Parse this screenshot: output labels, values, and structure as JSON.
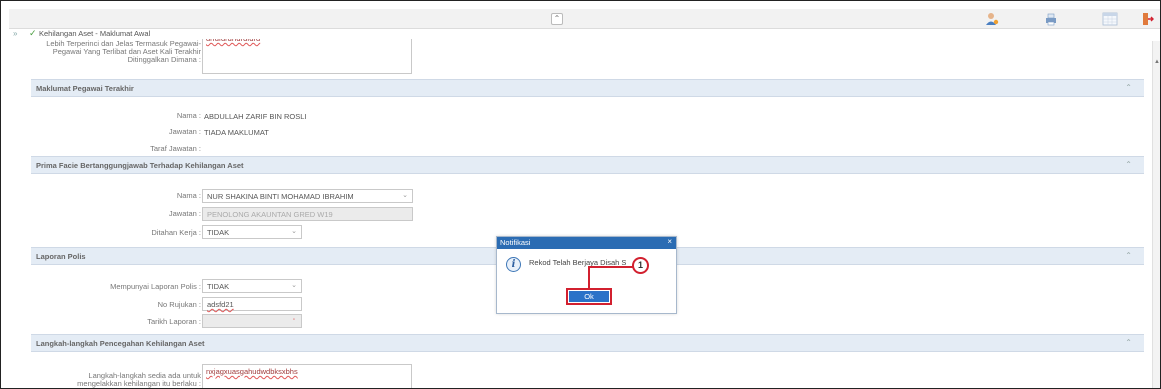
{
  "toolbar": {
    "collapse_icon": "double-chevron-up-icon",
    "icons": [
      "user-settings-icon",
      "print-icon",
      "calendar-icon",
      "logout-icon"
    ]
  },
  "breadcrumb": {
    "arrows": "»",
    "check": "✓",
    "label": "Kehilangan Aset - Maklumat Awal"
  },
  "top_section": {
    "label_lines": [
      "Lebih Terperinci dan Jelas Termasuk Pegawai-",
      "Pegawai Yang Terlibat dan Aset Kali Terakhir",
      "Ditinggalkan Dimana :"
    ],
    "textarea_value": "drfdfdrdrfdrdfdrd"
  },
  "pegawai_terakhir": {
    "title": "Maklumat Pegawai Terakhir",
    "nama_label": "Nama :",
    "nama_value": "ABDULLAH ZARIF BIN ROSLI",
    "jawatan_label": "Jawatan :",
    "jawatan_value": "TIADA MAKLUMAT",
    "taraf_label": "Taraf Jawatan :",
    "taraf_value": ""
  },
  "prima_facie": {
    "title": "Prima Facie Bertanggungjawab Terhadap Kehilangan Aset",
    "nama_label": "Nama :",
    "nama_value": "NUR SHAKINA BINTI MOHAMAD IBRAHIM",
    "jawatan_label": "Jawatan :",
    "jawatan_value": "PENOLONG AKAUNTAN GRED W19",
    "ditahan_label": "Ditahan Kerja :",
    "ditahan_value": "TIDAK"
  },
  "laporan_polis": {
    "title": "Laporan Polis",
    "mempunyai_label": "Mempunyai Laporan Polis :",
    "mempunyai_value": "TIDAK",
    "rujukan_label": "No Rujukan :",
    "rujukan_value": "adsfd21",
    "tarikh_label": "Tarikh Laporan :",
    "tarikh_value": ""
  },
  "langkah": {
    "title": "Langkah-langkah Pencegahan Kehilangan Aset",
    "label_lines": [
      "Langkah-langkah sedia ada untuk",
      "mengelakkan kehilangan itu berlaku :"
    ],
    "textarea_value": "nxjagxuasgahudwdbksxbhs"
  },
  "dialog": {
    "title": "Notifikasi",
    "close": "×",
    "info_glyph": "i",
    "message": "Rekod Telah Berjaya Disah S",
    "ok_label": "Ok",
    "callout_number": "1"
  },
  "colors": {
    "dialog_header": "#2b6cb3",
    "ok_button": "#2a72c8",
    "callout_red": "#d2202f",
    "section_header": "#e4ecf5"
  }
}
